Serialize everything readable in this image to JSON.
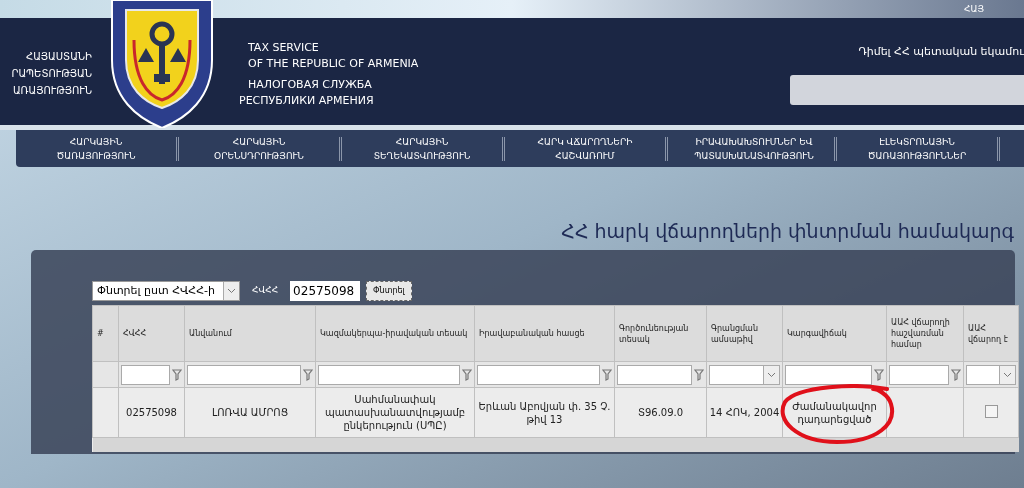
{
  "top_bar": {
    "language": "ՀԱՅ"
  },
  "header": {
    "org_name_lines": [
      "ՀԱՅԱՍՏԱՆԻ",
      "ՐԱՊԵՏՈՒԹՅԱՆ",
      "ԱՌԱՅՈՒԹՅՈՒՆ"
    ],
    "english_lines": [
      "TAX SERVICE",
      "OF THE REPUBLIC OF ARMENIA"
    ],
    "russian_lines": [
      "НАЛОГОВАЯ СЛУЖБА",
      "РЕСПУБЛИКИ АРМЕНИЯ"
    ],
    "appeal_link": "Դիմել ՀՀ պետական եկամու"
  },
  "nav": [
    {
      "line1": "ՀԱՐԿԱՅԻՆ",
      "line2": "ԾԱՌԱՅՈՒԹՅՈՒՆ"
    },
    {
      "line1": "ՀԱՐԿԱՅԻՆ",
      "line2": "ՕՐԵՆՍԴՐՈՒԹՅՈՒՆ"
    },
    {
      "line1": "ՀԱՐԿԱՅԻՆ",
      "line2": "ՏԵՂԵԿԱՏՎՈՒԹՅՈՒՆ"
    },
    {
      "line1": "ՀԱՐԿ ՎՃԱՐՈՂՆԵՐԻ",
      "line2": "ՀԱՇՎԱՌՈՒՄ"
    },
    {
      "line1": "ԻՐԱՎԱԽԱԽՏՈՒՄՆԵՐ ԵՎ",
      "line2": "ՊԱՏԱՍԽԱՆԱՏՎՈՒԹՅՈՒՆ"
    },
    {
      "line1": "ԷԼԵԿՏՐՈՆԱՅԻՆ",
      "line2": "ԾԱՌԱՅՈՒԹՅՈՒՆՆԵՐ"
    }
  ],
  "page_title": "ՀՀ հարկ վճարողների փնտրման համակարգ",
  "search": {
    "mode": "Փնտրել ըստ ՀՎՀՀ-ի",
    "field_label": "ՀՎՀՀ",
    "value": "02575098",
    "button": "Փնտրել"
  },
  "table": {
    "columns": [
      {
        "label": "#",
        "kind": "none"
      },
      {
        "label": "ՀՎՀՀ",
        "kind": "text"
      },
      {
        "label": "Անվանում",
        "kind": "text"
      },
      {
        "label": "Կազմակերպա-իրավական տեսակ",
        "kind": "text"
      },
      {
        "label": "Իրավաբանական հասցե",
        "kind": "text"
      },
      {
        "label": "Գործունեության տեսակ",
        "kind": "text"
      },
      {
        "label": "Գրանցման ամսաթիվ",
        "kind": "select"
      },
      {
        "label": "Կարգավիճակ",
        "kind": "text"
      },
      {
        "label": "ԱԱՀ վճարողի հաշվառման համար",
        "kind": "text"
      },
      {
        "label": "ԱԱՀ վճարող է",
        "kind": "select"
      }
    ],
    "rows": [
      {
        "tin": "02575098",
        "name": "ԼՈՌՎԱ ԱՄՐՈՑ",
        "legal_form": "Սահմանափակ պատասխանատվությամբ ընկերություն (ՍՊԸ)",
        "address": "Երևան Աբովյան փ. 35 Չ. թիվ 13",
        "activity": "Տ96.09.0",
        "registered": "14 ՀՈԿ, 2004",
        "status": "Ժամանակավոր դադարեցված",
        "status_circled": true,
        "vat_payer": false
      }
    ]
  }
}
